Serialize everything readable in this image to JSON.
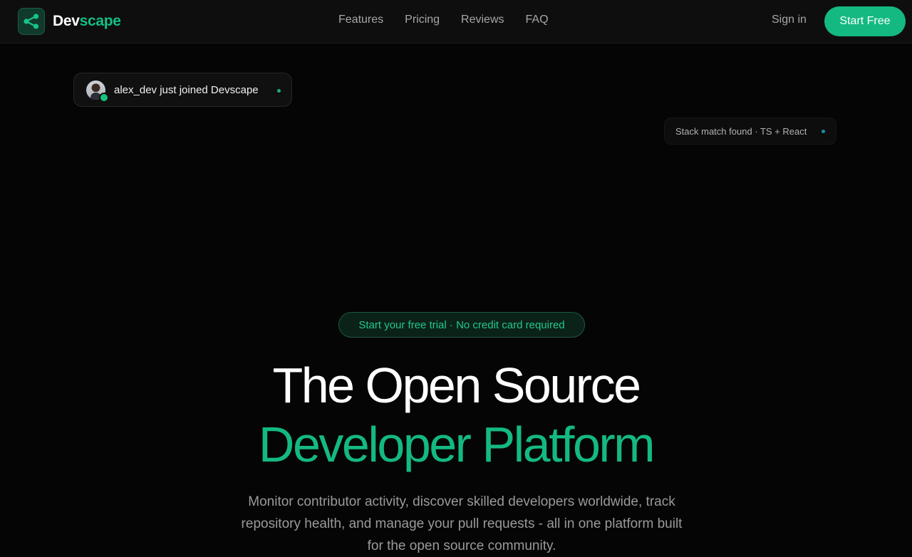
{
  "brand": {
    "name_part1": "Dev",
    "name_part2": "scape",
    "icon": "share-nodes-icon",
    "accent": "#14b981"
  },
  "nav": {
    "items": [
      {
        "label": "Features"
      },
      {
        "label": "Pricing"
      },
      {
        "label": "Reviews"
      },
      {
        "label": "FAQ"
      }
    ],
    "signin_label": "Sign in",
    "cta_label": "Start Free"
  },
  "notifications": {
    "join_toast": {
      "text": "alex_dev just joined Devscape",
      "status_color": "#18b479"
    },
    "match_chip": {
      "text": "Stack match found · TS + React",
      "status_color": "#1aa7c7"
    }
  },
  "hero": {
    "badge": "Start your free trial · No credit card required",
    "title_line1": "The Open Source",
    "title_line2": "Developer Platform",
    "subtitle": "Monitor contributor activity, discover skilled developers worldwide, track repository health, and manage your pull requests - all in one platform built for the open source community."
  }
}
